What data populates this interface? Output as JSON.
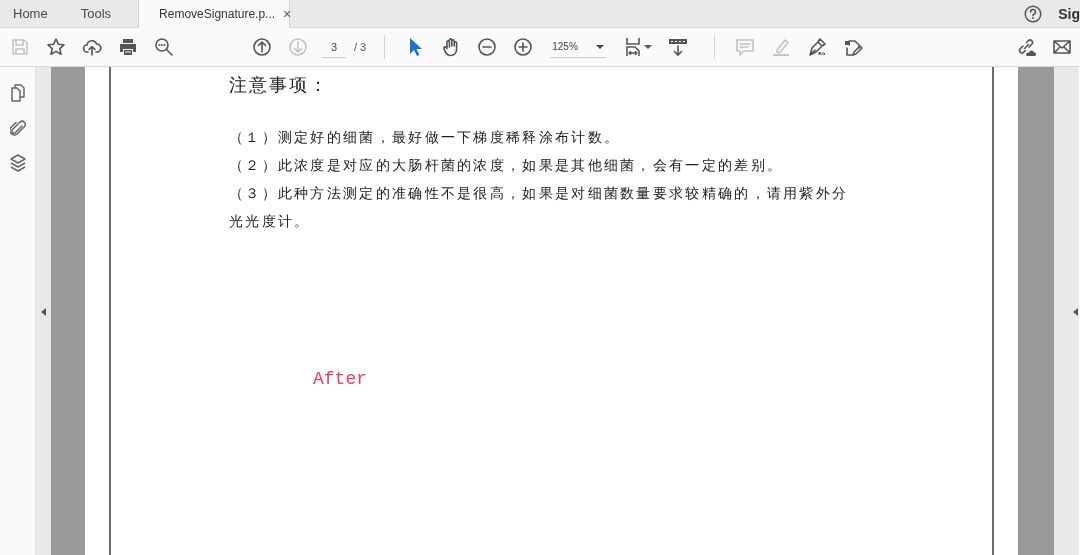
{
  "tabs": [
    {
      "label": "Home",
      "selected": false
    },
    {
      "label": "Tools",
      "selected": false
    },
    {
      "label": "RemoveSignature.p...",
      "selected": true,
      "close": "×"
    }
  ],
  "header_right": {
    "account_label": "Sig"
  },
  "toolbar": {
    "file_buttons": [
      {
        "disabled": true
      },
      {
        "disabled": false
      },
      {
        "disabled": false
      },
      {
        "disabled": false
      },
      {
        "disabled": false
      }
    ],
    "nav_buttons": [
      {
        "disabled": false
      },
      {
        "disabled": true
      }
    ],
    "page_field": {
      "value": "3"
    },
    "page_total": "/ 3",
    "tool_buttons": [
      {
        "selected": true
      },
      {
        "selected": false
      },
      {
        "selected": false
      },
      {
        "selected": false
      }
    ],
    "zoom_field": {
      "value": "125%"
    },
    "annotate_buttons": [
      {
        "disabled": true
      },
      {
        "disabled": true
      },
      {
        "disabled": false
      },
      {
        "disabled": false
      }
    ]
  },
  "document": {
    "heading": "注意事项：",
    "items": [
      "（１）测定好的细菌，最好做一下梯度稀释涂布计数。",
      "（２）此浓度是对应的大肠杆菌的浓度，如果是其他细菌，会有一定的差别。",
      "（３）此种方法测定的准确性不是很高，如果是对细菌数量要求较精确的，请用紫外分光光度计。"
    ],
    "note": "After"
  }
}
